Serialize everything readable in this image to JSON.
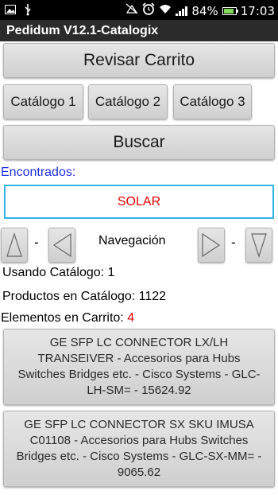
{
  "status_bar": {
    "battery": "84%",
    "time": "17:03",
    "battery_level": 0.84,
    "icons": [
      "image-icon",
      "usb-icon",
      "mute-icon",
      "alarm-icon",
      "wifi-icon",
      "signal-icon",
      "battery-icon"
    ]
  },
  "app": {
    "title": "Pedidum V12.1-Catalogix"
  },
  "buttons": {
    "review_cart": "Revisar Carrito",
    "catalogs": [
      "Catálogo 1",
      "Catálogo 2",
      "Catálogo 3"
    ],
    "search": "Buscar"
  },
  "search": {
    "found_label": "Encontrados:",
    "value": "SOLAR"
  },
  "navigation": {
    "label": "Navegación",
    "separator": "-"
  },
  "info": {
    "using_catalog": "Usando Catálogo: 1",
    "products_in_catalog": "Productos en Catálogo: 1122",
    "cart_items_label": "Elementos en Carrito:",
    "cart_items_count": "4"
  },
  "products": [
    {
      "text": "GE SFP LC CONNECTOR LX/LH TRANSEIVER - Accesorios para Hubs Switches Bridges etc. - Cisco Systems - GLC-LH-SM= - 15624.92"
    },
    {
      "text": "GE SFP LC CONNECTOR SX SKU IMUSA C01108 - Accesorios para Hubs Switches Bridges etc. - Cisco Systems - GLC-SX-MM= - 9065.62"
    }
  ],
  "colors": {
    "accent_blue": "#33b5e5",
    "link_blue": "#1e2ee6",
    "alert_red": "#e00000"
  }
}
